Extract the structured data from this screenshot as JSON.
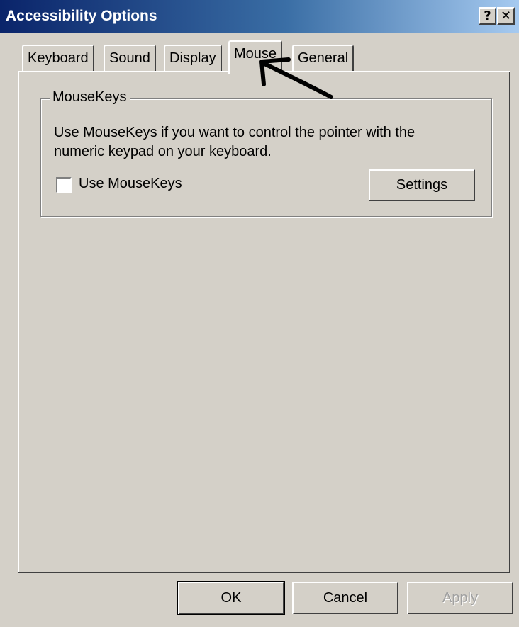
{
  "window": {
    "title": "Accessibility Options",
    "help_label": "?",
    "close_label": "✕"
  },
  "tabs": [
    {
      "label": "Keyboard",
      "active": false
    },
    {
      "label": "Sound",
      "active": false
    },
    {
      "label": "Display",
      "active": false
    },
    {
      "label": "Mouse",
      "active": true
    },
    {
      "label": "General",
      "active": false
    }
  ],
  "mousekeys": {
    "group_label": "MouseKeys",
    "description": "Use MouseKeys if you want to control the pointer with the numeric keypad on your keyboard.",
    "checkbox_label": "Use MouseKeys",
    "checked": false,
    "settings_label": "Settings"
  },
  "footer": {
    "ok_label": "OK",
    "cancel_label": "Cancel",
    "apply_label": "Apply"
  },
  "annotation": {
    "icon": "hand-drawn-arrow-icon",
    "color": "#000000"
  }
}
